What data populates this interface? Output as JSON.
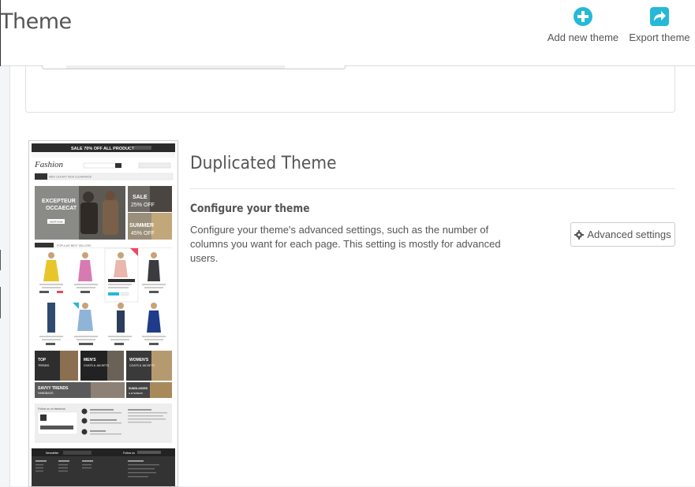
{
  "header": {
    "title": "Theme",
    "add_label": "Add new theme",
    "export_label": "Export theme"
  },
  "theme": {
    "name": "Duplicated Theme",
    "configure_title": "Configure your theme",
    "configure_desc": "Configure your theme's advanced settings, such as the number of columns you want for each page. This setting is mostly for advanced users.",
    "advanced_button": "Advanced settings"
  },
  "preview": {
    "promo": "SALE 70% OFF ALL PRODUCTS",
    "logo": "Fashion",
    "nav": [
      "WOMEN",
      "MEN",
      "LUXURY",
      "KIDS",
      "CLEARANCE"
    ],
    "hero_title": "EXCEPTEUR OCCAECAT",
    "hero_button": "SHOP NOW",
    "side1": "SALE 25% OFF",
    "side2": "SUMMER 45% OFF",
    "tabs": [
      "NEW ARRIVALS",
      "POPULAR",
      "BEST SELLERS"
    ],
    "banners": [
      "TOP TRENDS",
      "MEN'S COATS & JACKETS",
      "WOMEN'S COATS & JACKETS",
      "SAVVY TRENDS HANDBAGS",
      "SUNGLASSES & EYEWEAR"
    ],
    "footer_news": "Newsletter",
    "footer_follow": "Follow us"
  },
  "colors": {
    "accent": "#25b9d7",
    "text": "#555555",
    "dark": "#333333"
  }
}
